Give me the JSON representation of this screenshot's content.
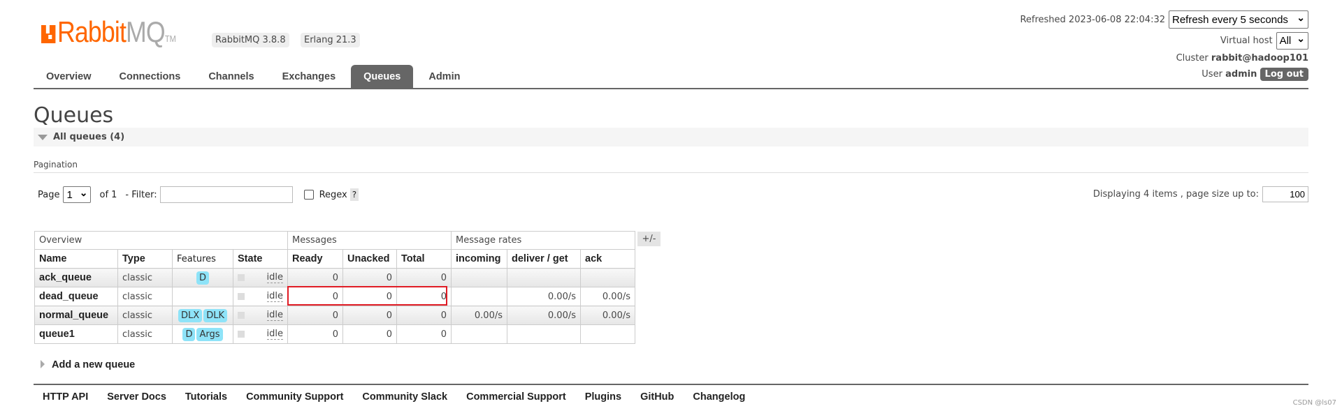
{
  "header": {
    "logo_text": "RabbitMQ",
    "logo_rabbit": "Rabbit",
    "logo_mq": "MQ",
    "logo_tm": "TM",
    "version": "RabbitMQ 3.8.8",
    "erlang": "Erlang 21.3",
    "refreshed": "Refreshed 2023-06-08 22:04:32",
    "refresh_select": "Refresh every 5 seconds",
    "vhost_label": "Virtual host",
    "vhost_select": "All",
    "cluster_label": "Cluster",
    "cluster_name": "rabbit@hadoop101",
    "user_label": "User",
    "user_name": "admin",
    "logout": "Log out"
  },
  "nav": {
    "tabs": [
      "Overview",
      "Connections",
      "Channels",
      "Exchanges",
      "Queues",
      "Admin"
    ],
    "active": "Queues"
  },
  "page": {
    "title": "Queues",
    "section": "All queues (4)",
    "pagination_label": "Pagination",
    "page_label": "Page",
    "page_value": "1",
    "of": "of 1",
    "filter_label": "- Filter:",
    "filter_value": "",
    "regex_label": "Regex",
    "regex_help": "?",
    "displaying": "Displaying 4 items , page size up to:",
    "page_size": "100"
  },
  "table": {
    "groups": [
      "Overview",
      "Messages",
      "Message rates"
    ],
    "columns": [
      "Name",
      "Type",
      "Features",
      "State",
      "Ready",
      "Unacked",
      "Total",
      "incoming",
      "deliver / get",
      "ack"
    ],
    "toggle": "+/-",
    "rows": [
      {
        "name": "ack_queue",
        "type": "classic",
        "features": [
          "D"
        ],
        "state": "idle",
        "ready": "0",
        "unacked": "0",
        "total": "0",
        "incoming": "",
        "deliver": "",
        "ack": ""
      },
      {
        "name": "dead_queue",
        "type": "classic",
        "features": [],
        "state": "idle",
        "ready": "0",
        "unacked": "0",
        "total": "0",
        "incoming": "",
        "deliver": "0.00/s",
        "ack": "0.00/s"
      },
      {
        "name": "normal_queue",
        "type": "classic",
        "features": [
          "DLX",
          "DLK"
        ],
        "state": "idle",
        "ready": "0",
        "unacked": "0",
        "total": "0",
        "incoming": "0.00/s",
        "deliver": "0.00/s",
        "ack": "0.00/s"
      },
      {
        "name": "queue1",
        "type": "classic",
        "features": [
          "D",
          "Args"
        ],
        "state": "idle",
        "ready": "0",
        "unacked": "0",
        "total": "0",
        "incoming": "",
        "deliver": "",
        "ack": ""
      }
    ]
  },
  "add_queue": "Add a new queue",
  "footer": [
    "HTTP API",
    "Server Docs",
    "Tutorials",
    "Community Support",
    "Community Slack",
    "Commercial Support",
    "Plugins",
    "GitHub",
    "Changelog"
  ],
  "watermark": "CSDN @ls07",
  "colors": {
    "brand": "#ff6600",
    "tab_active": "#666666",
    "feature_badge": "#8ee3f8",
    "highlight_box": "#e01b24"
  }
}
